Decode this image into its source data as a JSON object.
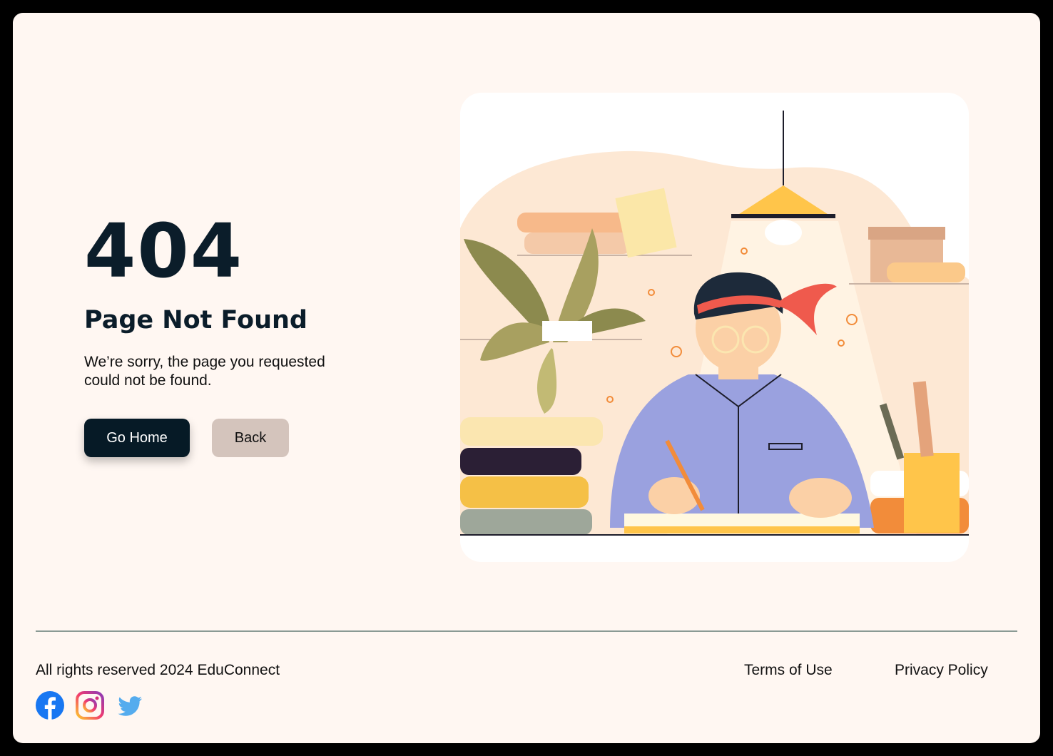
{
  "error": {
    "code": "404",
    "title": "Page Not Found",
    "message": "We’re sorry, the page you requested could not be found."
  },
  "buttons": {
    "home": "Go Home",
    "back": "Back"
  },
  "illustration": {
    "subject": "student writing at desk under lamp",
    "icon": "illustration-student-studying"
  },
  "footer": {
    "copyright": "All rights reserved 2024 EduConnect",
    "links": {
      "terms": "Terms of Use",
      "privacy": "Privacy Policy"
    },
    "social": [
      "facebook-icon",
      "instagram-icon",
      "twitter-icon"
    ]
  },
  "colors": {
    "page_background": "#fff7f2",
    "primary_button": "#061a26",
    "secondary_button": "#d4c4bc",
    "text_dark": "#0b1d2a",
    "facebook": "#1877f2",
    "twitter": "#55acee"
  }
}
